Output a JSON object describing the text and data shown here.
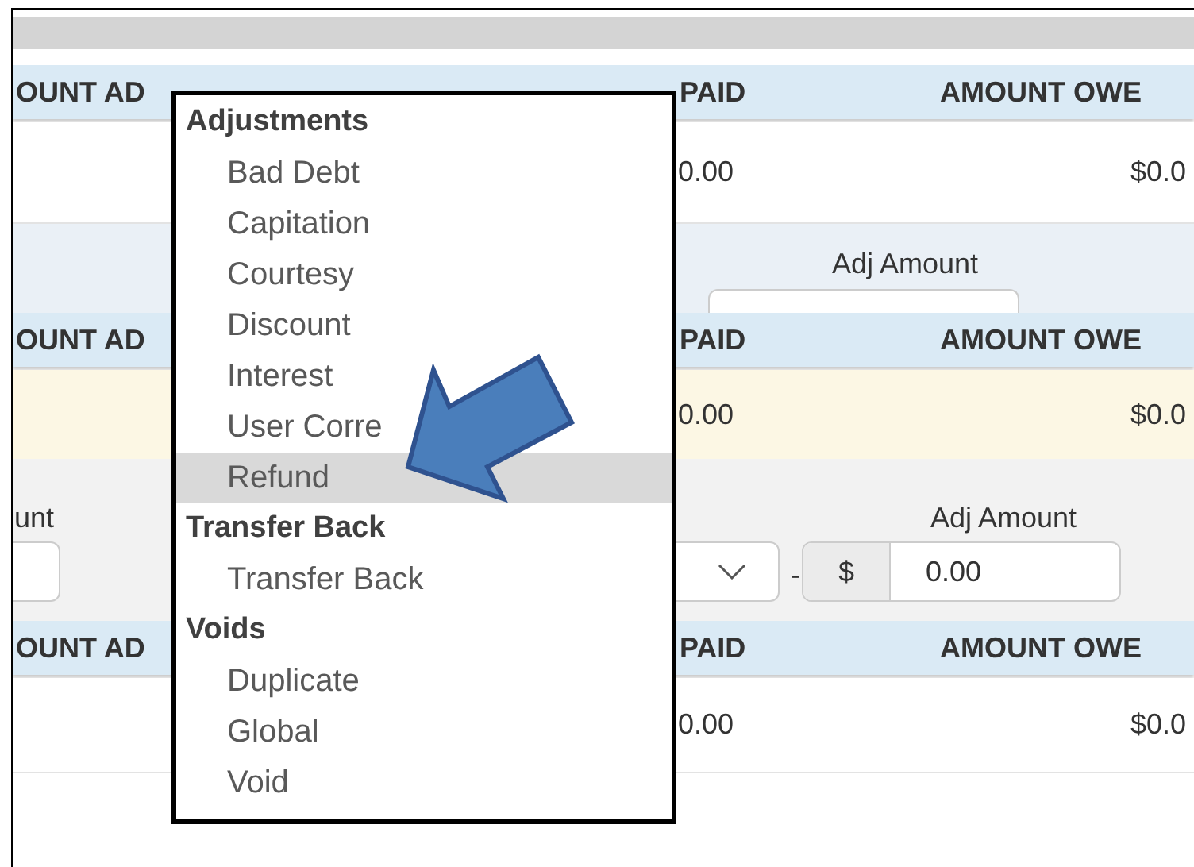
{
  "sections": [
    {
      "headers": [
        "OUNT AD",
        "PAID",
        "AMOUNT OWE"
      ],
      "values": [
        "0.00",
        "$0.0"
      ],
      "highlighted": false
    },
    {
      "headers": [
        "OUNT AD",
        "PAID",
        "AMOUNT OWE"
      ],
      "values": [
        "0.00",
        "$0.0"
      ],
      "highlighted": true
    },
    {
      "headers": [
        "OUNT AD",
        "PAID",
        "AMOUNT OWE"
      ],
      "values": [
        "0.00",
        "$0.0"
      ],
      "highlighted": false
    }
  ],
  "panel_1": {
    "amount_label": "Adj Amount"
  },
  "panel_2": {
    "amount_label_left": "unt",
    "amount_label": "Adj Amount",
    "separator": "-",
    "currency": "$",
    "amount": "0.00"
  },
  "menu": [
    {
      "kind": "group",
      "label": "Adjustments"
    },
    {
      "kind": "option",
      "label": "Bad Debt",
      "selected": false
    },
    {
      "kind": "option",
      "label": "Capitation",
      "selected": false
    },
    {
      "kind": "option",
      "label": "Courtesy",
      "selected": false
    },
    {
      "kind": "option",
      "label": "Discount",
      "selected": false
    },
    {
      "kind": "option",
      "label": "Interest",
      "selected": false
    },
    {
      "kind": "option",
      "label": "User Corre",
      "selected": false
    },
    {
      "kind": "option",
      "label": "Refund",
      "selected": true
    },
    {
      "kind": "group",
      "label": "Transfer Back"
    },
    {
      "kind": "option",
      "label": "Transfer Back",
      "selected": false
    },
    {
      "kind": "group",
      "label": "Voids"
    },
    {
      "kind": "option",
      "label": "Duplicate",
      "selected": false
    },
    {
      "kind": "option",
      "label": "Global",
      "selected": false
    },
    {
      "kind": "option",
      "label": "Void",
      "selected": false
    }
  ]
}
